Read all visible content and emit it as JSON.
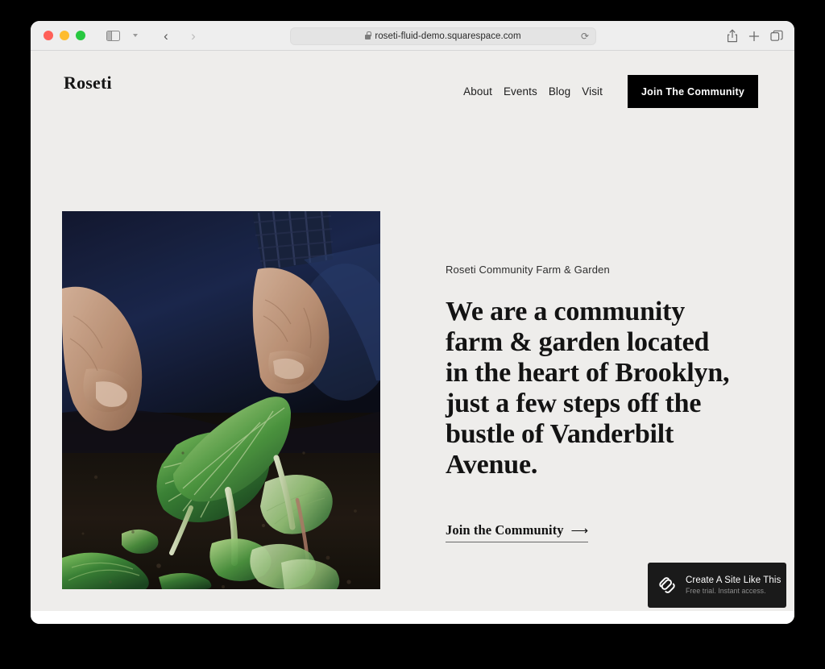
{
  "browser": {
    "traffic_lights": {
      "close": "close-window",
      "minimize": "minimize-window",
      "maximize": "maximize-window"
    },
    "sidebar_toggle": "sidebar-icon",
    "tab_overview_chevron": "chevron-down-icon",
    "back_arrow": "‹",
    "forward_arrow": "›",
    "address": {
      "url": "roseti-fluid-demo.squarespace.com",
      "lock": "lock-icon",
      "reload": "⟳"
    },
    "right_icons": [
      {
        "name": "share-icon",
        "glyph": "share"
      },
      {
        "name": "new-tab-icon",
        "glyph": "+"
      },
      {
        "name": "tab-overview-icon",
        "glyph": "tabs"
      }
    ]
  },
  "site": {
    "logo": "Roseti",
    "nav": [
      {
        "label": "About"
      },
      {
        "label": "Events"
      },
      {
        "label": "Blog"
      },
      {
        "label": "Visit"
      }
    ],
    "cta_button": "Join The Community",
    "hero": {
      "eyebrow": "Roseti Community Farm & Garden",
      "heading": "We are a community farm & garden located in the heart of Brooklyn, just a few steps off the bustle of Vanderbilt Avenue.",
      "link_label": "Join the Community",
      "link_arrow": "⟶",
      "image_alt": "Hands holding a leafy green seedling in dark garden soil"
    }
  },
  "badge": {
    "logo": "squarespace-logo-icon",
    "title": "Create A Site Like This",
    "subtitle": "Free trial. Instant access."
  },
  "colors": {
    "page_background": "#eeedeb",
    "accent_black": "#000000",
    "toolbar": "#eeeeee",
    "badge_background": "#1a1a1a",
    "text_primary": "#131313"
  }
}
